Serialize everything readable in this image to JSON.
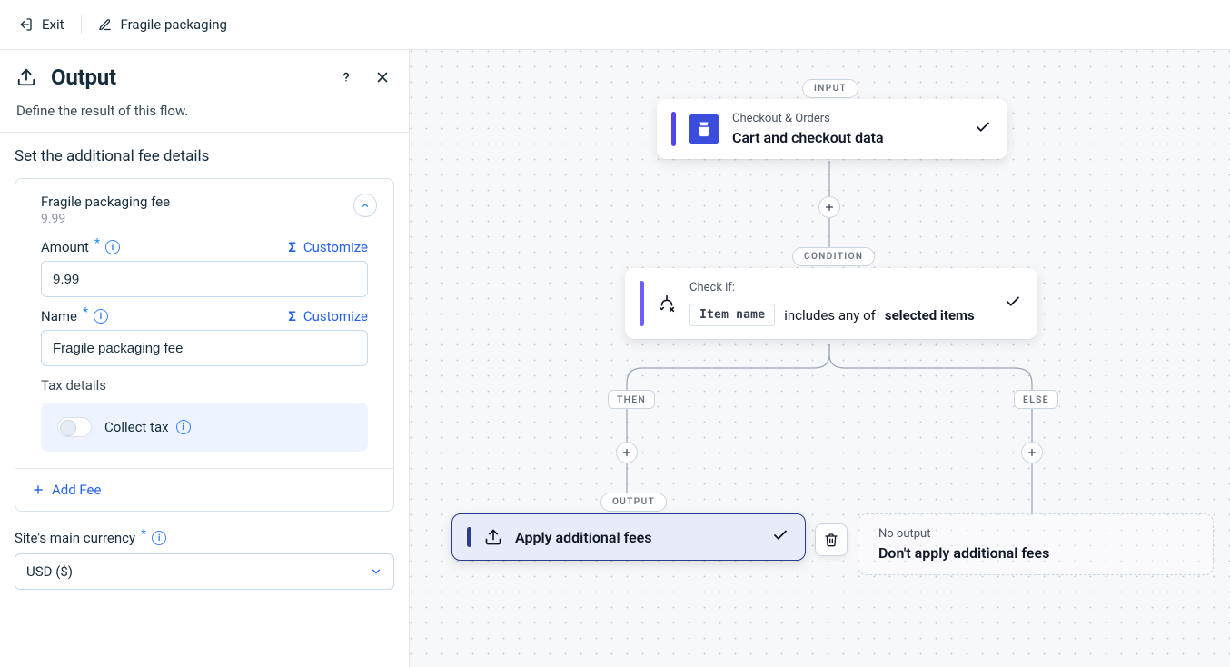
{
  "topbar": {
    "exit": "Exit",
    "flow_title": "Fragile packaging"
  },
  "panel": {
    "title": "Output",
    "subtitle": "Define the result of this flow.",
    "section_title": "Set the additional fee details",
    "fee": {
      "name": "Fragile packaging fee",
      "preview_amount": "9.99",
      "amount_label": "Amount",
      "amount_value": "9.99",
      "name_label": "Name",
      "name_value": "Fragile packaging fee",
      "customize": "Customize",
      "tax_label": "Tax details",
      "collect_tax": "Collect tax"
    },
    "add_fee": "Add Fee",
    "currency_label": "Site's main currency",
    "currency_value": "USD ($)"
  },
  "canvas": {
    "input_tag": "INPUT",
    "input_node": {
      "sub": "Checkout & Orders",
      "title": "Cart and checkout data"
    },
    "condition_tag": "CONDITION",
    "condition": {
      "check_if": "Check if:",
      "chip": "Item name",
      "mid": "includes any of",
      "end": "selected items"
    },
    "then": "THEN",
    "else": "ELSE",
    "output_tag": "OUTPUT",
    "output": "Apply additional fees",
    "no_output_sub": "No output",
    "no_output_title": "Don't apply additional fees"
  }
}
